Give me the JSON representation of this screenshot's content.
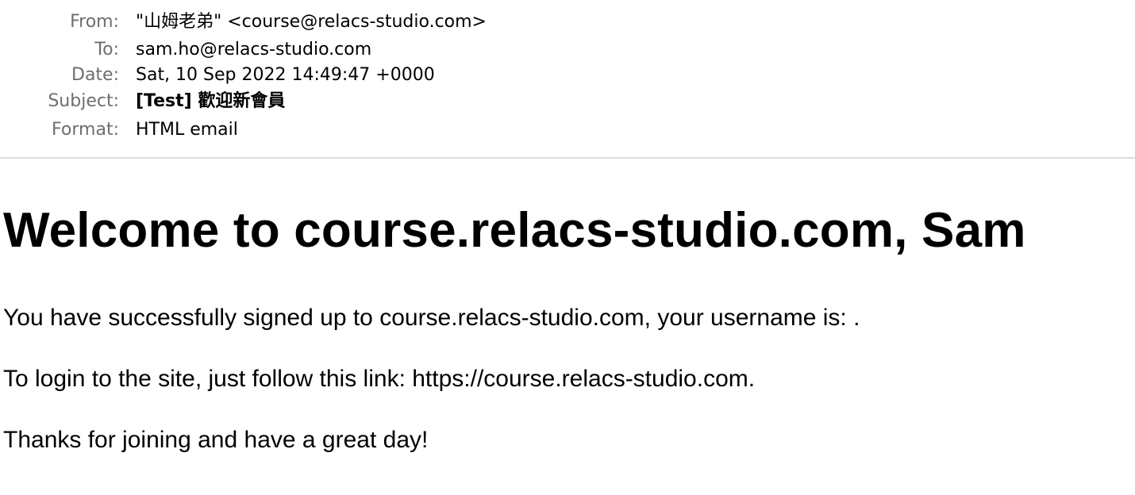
{
  "headers": [
    {
      "label": "From:",
      "value": "\"山姆老弟\" <course@relacs-studio.com>",
      "bold": false
    },
    {
      "label": "To:",
      "value": "sam.ho@relacs-studio.com",
      "bold": false
    },
    {
      "label": "Date:",
      "value": "Sat, 10 Sep 2022 14:49:47 +0000",
      "bold": false
    },
    {
      "label": "Subject:",
      "value": "[Test] 歡迎新會員",
      "bold": true
    },
    {
      "label": "Format:",
      "value": "HTML email",
      "bold": false
    }
  ],
  "email": {
    "title": "Welcome to course.relacs-studio.com, Sam",
    "paragraphs": [
      "You have successfully signed up to course.relacs-studio.com, your username is: .",
      "To login to the site, just follow this link: https://course.relacs-studio.com.",
      "Thanks for joining and have a great day!"
    ]
  }
}
